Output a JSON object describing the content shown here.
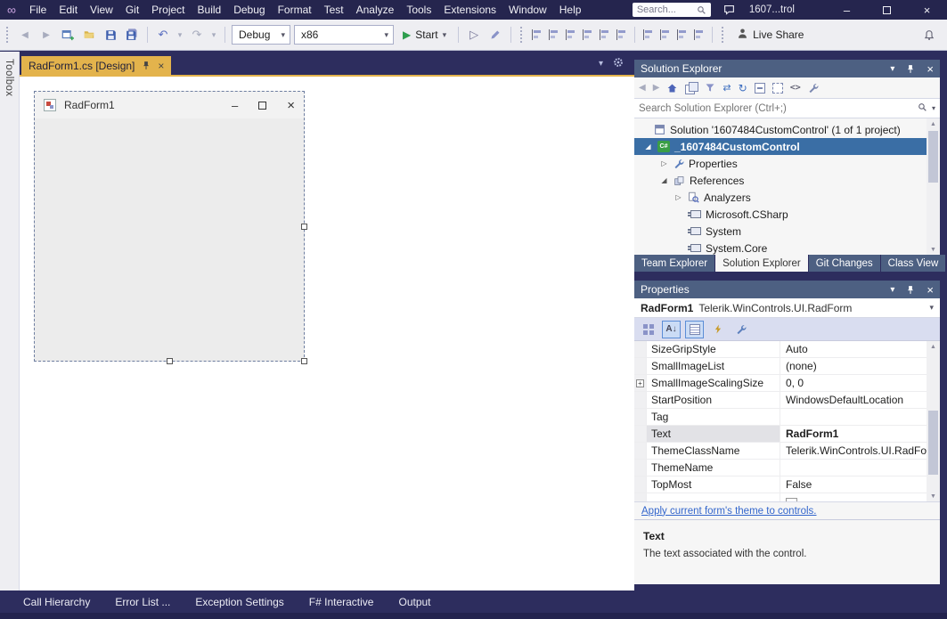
{
  "title_bar": {
    "menus": [
      "File",
      "Edit",
      "View",
      "Git",
      "Project",
      "Build",
      "Debug",
      "Format",
      "Test",
      "Analyze",
      "Tools",
      "Extensions",
      "Window",
      "Help"
    ],
    "search_placeholder": "Search...",
    "window_title": "1607...trol"
  },
  "toolbar": {
    "debug_target": "Debug",
    "platform": "x86",
    "start_label": "Start",
    "live_share_label": "Live Share"
  },
  "toolbox": {
    "label": "Toolbox"
  },
  "document": {
    "tab_label": "RadForm1.cs [Design]",
    "form_title": "RadForm1"
  },
  "solution_explorer": {
    "title": "Solution Explorer",
    "search_placeholder": "Search Solution Explorer (Ctrl+;)",
    "tree": [
      {
        "label": "Solution '1607484CustomControl' (1 of 1 project)"
      },
      {
        "label": "_1607484CustomControl"
      },
      {
        "label": "Properties"
      },
      {
        "label": "References"
      },
      {
        "label": "Analyzers"
      },
      {
        "label": "Microsoft.CSharp"
      },
      {
        "label": "System"
      },
      {
        "label": "System.Core"
      }
    ],
    "tabs": [
      "Team Explorer",
      "Solution Explorer",
      "Git Changes",
      "Class View"
    ]
  },
  "properties": {
    "title": "Properties",
    "object_name": "RadForm1",
    "object_type": "Telerik.WinControls.UI.RadForm",
    "rows": [
      {
        "name": "SizeGripStyle",
        "value": "Auto"
      },
      {
        "name": "SmallImageList",
        "value": "(none)"
      },
      {
        "name": "SmallImageScalingSize",
        "value": "0, 0"
      },
      {
        "name": "StartPosition",
        "value": "WindowsDefaultLocation"
      },
      {
        "name": "Tag",
        "value": ""
      },
      {
        "name": "Text",
        "value": "RadForm1"
      },
      {
        "name": "ThemeClassName",
        "value": "Telerik.WinControls.UI.RadFor"
      },
      {
        "name": "ThemeName",
        "value": ""
      },
      {
        "name": "TopMost",
        "value": "False"
      }
    ],
    "link_text": "Apply current form's theme to controls.",
    "description_title": "Text",
    "description_body": "The text associated with the control."
  },
  "bottom_tabs": [
    "Call Hierarchy",
    "Error List ...",
    "Exception Settings",
    "F# Interactive",
    "Output"
  ],
  "icons": {
    "caret_down": "▾",
    "close": "×",
    "minimize": "–",
    "play": "▶",
    "play_outline": "▷",
    "back": "◀",
    "forward": "▶",
    "undo": "↶",
    "redo": "↷",
    "sync": "⇄",
    "refresh": "↻",
    "code": "<>",
    "infinity": "∞",
    "tree_expanded": "◢",
    "tree_collapsed": "▷",
    "plus": "+",
    "scroll_up": "▲",
    "scroll_down": "▼",
    "csharp_badge": "C#",
    "alpha_sort": "A↓"
  }
}
